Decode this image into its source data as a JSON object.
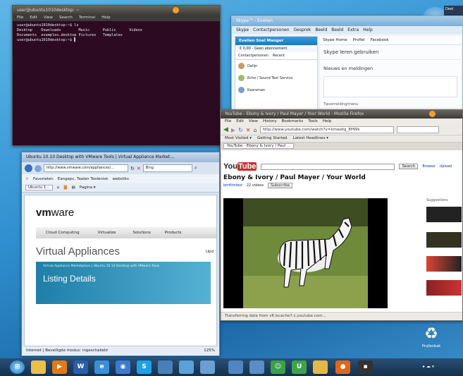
{
  "terminal": {
    "title": "user@ubuntu1010desktop: ~",
    "menu": [
      "File",
      "Edit",
      "View",
      "Search",
      "Terminal",
      "Help"
    ],
    "lines": [
      "user@ubuntu1010desktop:~$ ls",
      "Desktop    Downloads        Music      Public      Videos",
      "Documents  examples.desktop Pictures   Templates",
      "user@ubuntu1010desktop:~$ ▌"
    ]
  },
  "skype": {
    "title": "Skype™ - Evelien",
    "menu": [
      "Skype",
      "Contactpersonen",
      "Gesprek",
      "Beeld",
      "Beeld",
      "Extra",
      "Help"
    ],
    "user_name": "Evelien Snel Manger",
    "credit": "€ 0,00 - Geen abonnement",
    "tab_contacts": "Contactpersonen",
    "tab_recent": "Recent",
    "contacts": [
      "Delijn",
      "Echo / Sound Test Service",
      "Kaarsman"
    ],
    "home_tab": "Skype Home",
    "profile_tab": "Profiel",
    "facebook_tab": "Facebook",
    "learn": "Skype leren gebruiken",
    "news": "Nieuws en meldingen",
    "footer": "Tipsomelding/menu"
  },
  "firefox": {
    "title": "YouTube - Ebony & Ivory / Paul Mayer / Your World - Mozilla Firefox",
    "menu": [
      "File",
      "Edit",
      "View",
      "History",
      "Bookmarks",
      "Tools",
      "Help"
    ],
    "url": "http://www.youtube.com/watch?v=kmwetg_8HWk",
    "bookmarks": [
      "Most Visited ▾",
      "Getting Started",
      "Latest Headlines ▾"
    ],
    "tab": "YouTube - Ebony & Ivory / Paul ...",
    "search_button": "Search",
    "browse": "Browse",
    "upload": "Upload",
    "video_title": "Ebony & Ivory / Paul Mayer / Your World",
    "channel": "bmfilmfest",
    "videos": "22 videos",
    "subscribe": "Subscribe",
    "suggestions": "Suggestions",
    "status": "Transferring data from v6.lscache7.c.youtube.com..."
  },
  "ie": {
    "title": "Ubuntu 10.10 Desktop with VMware Tools | Virtual Appliance Market...",
    "address": "http://www.vmware.com/appliances/...",
    "search": "Bing",
    "favorites": "Favorieten",
    "suggested": "Eangepc. Taalen Toolenisk",
    "webslices": "websliks",
    "tab_label": "Ubuntu 1...",
    "page_menu": "Pagina ▾",
    "logo_vm": "vm",
    "logo_ware": "ware",
    "nav": [
      "Cloud Computing",
      "Virtualize",
      "Solutions",
      "Products"
    ],
    "heading": "Virtual Appliances",
    "upd": "Upd",
    "breadcrumb": "Virtual Appliance Marketplace | Ubuntu 10.10 Desktop with VMware Tools",
    "listing": "Listing Details",
    "status": "Internet | Beveiligde modus: ingeschakeld",
    "zoom": "125%"
  },
  "desktop": {
    "recycle": "Prullenbak",
    "user_tile": "Deel"
  },
  "taskbar": {
    "time": "▸ ☁ ⏸",
    "items": [
      "start",
      "folder",
      "media",
      "word",
      "ie",
      "chrome",
      "skype",
      "calc",
      "paint",
      "doc",
      "settings",
      "app",
      "people",
      "ubuntu",
      "photos",
      "firefox",
      "terminal"
    ]
  }
}
